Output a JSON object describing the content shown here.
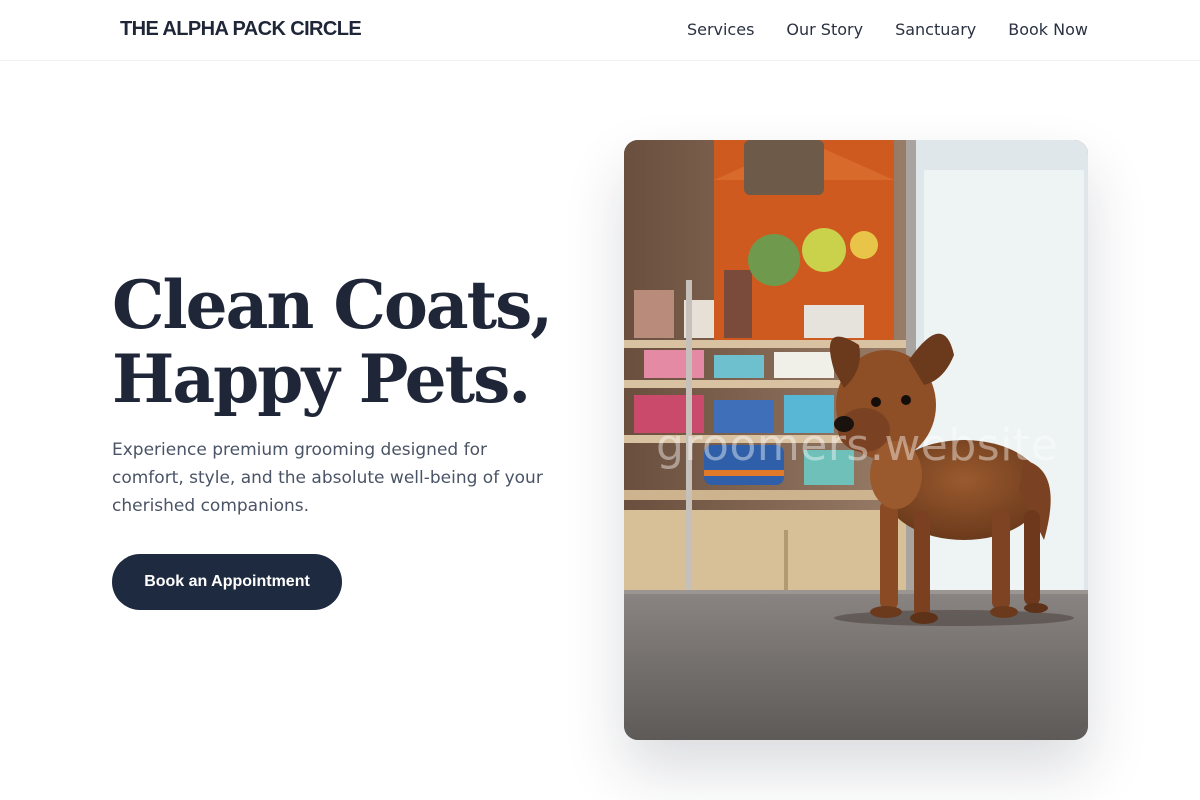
{
  "header": {
    "brand": "THE ALPHA PACK CIRCLE",
    "nav": [
      "Services",
      "Our Story",
      "Sanctuary",
      "Book Now"
    ]
  },
  "hero": {
    "headline_line1": "Clean Coats,",
    "headline_line2": "Happy Pets.",
    "subtitle": "Experience premium grooming designed for comfort, style, and the absolute well-being of your cherished companions.",
    "cta_label": "Book an Appointment",
    "image_alt": "A small brown fluffy puppy standing on a shiny floor inside a pet shop",
    "watermark": "groomers.website"
  },
  "colors": {
    "primary": "#1e2a3f",
    "text": "#1e2638",
    "muted": "#4a5466",
    "background": "#ffffff"
  }
}
